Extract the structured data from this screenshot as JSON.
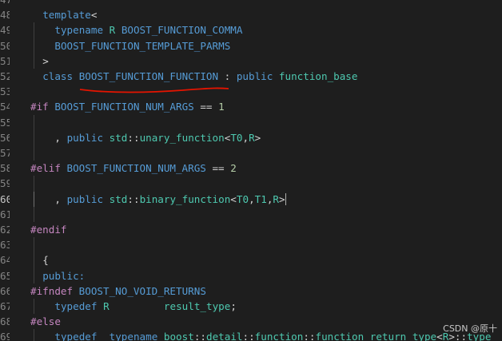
{
  "editor": {
    "lines": [
      {
        "num": "47",
        "tokens": []
      },
      {
        "num": "48",
        "tokens": [
          {
            "t": "template",
            "c": "t-kw"
          },
          {
            "t": "<",
            "c": "t-plain"
          }
        ]
      },
      {
        "num": "49",
        "tokens": [
          {
            "t": "typename ",
            "c": "t-kw"
          },
          {
            "t": "R ",
            "c": "t-param"
          },
          {
            "t": "BOOST_FUNCTION_COMMA",
            "c": "t-mac"
          }
        ]
      },
      {
        "num": "50",
        "tokens": [
          {
            "t": "BOOST_FUNCTION_TEMPLATE_PARMS",
            "c": "t-mac"
          }
        ]
      },
      {
        "num": "51",
        "tokens": [
          {
            "t": ">",
            "c": "t-plain"
          }
        ]
      },
      {
        "num": "52",
        "tokens": [
          {
            "t": "class ",
            "c": "t-kw"
          },
          {
            "t": "BOOST_FUNCTION_FUNCTION",
            "c": "t-mac"
          },
          {
            "t": " : ",
            "c": "t-plain"
          },
          {
            "t": "public ",
            "c": "t-kw"
          },
          {
            "t": "function_base",
            "c": "t-type"
          }
        ]
      },
      {
        "num": "53",
        "tokens": []
      },
      {
        "num": "54",
        "tokens": [
          {
            "t": "#if ",
            "c": "t-pp"
          },
          {
            "t": "BOOST_FUNCTION_NUM_ARGS",
            "c": "t-mac"
          },
          {
            "t": " == ",
            "c": "t-plain"
          },
          {
            "t": "1",
            "c": "t-num"
          }
        ]
      },
      {
        "num": "55",
        "tokens": []
      },
      {
        "num": "56",
        "tokens": [
          {
            "t": ", ",
            "c": "t-plain"
          },
          {
            "t": "public ",
            "c": "t-kw"
          },
          {
            "t": "std",
            "c": "t-ns"
          },
          {
            "t": "::",
            "c": "t-plain"
          },
          {
            "t": "unary_function",
            "c": "t-type"
          },
          {
            "t": "<",
            "c": "t-plain"
          },
          {
            "t": "T0",
            "c": "t-type"
          },
          {
            "t": ",",
            "c": "t-plain"
          },
          {
            "t": "R",
            "c": "t-type"
          },
          {
            "t": ">",
            "c": "t-plain"
          }
        ]
      },
      {
        "num": "57",
        "tokens": []
      },
      {
        "num": "58",
        "tokens": [
          {
            "t": "#elif ",
            "c": "t-pp"
          },
          {
            "t": "BOOST_FUNCTION_NUM_ARGS",
            "c": "t-mac"
          },
          {
            "t": " == ",
            "c": "t-plain"
          },
          {
            "t": "2",
            "c": "t-num"
          }
        ]
      },
      {
        "num": "59",
        "tokens": []
      },
      {
        "num": "60",
        "tokens": [
          {
            "t": ", ",
            "c": "t-plain"
          },
          {
            "t": "public ",
            "c": "t-kw"
          },
          {
            "t": "std",
            "c": "t-ns"
          },
          {
            "t": "::",
            "c": "t-plain"
          },
          {
            "t": "binary_function",
            "c": "t-type"
          },
          {
            "t": "<",
            "c": "t-plain"
          },
          {
            "t": "T0",
            "c": "t-type"
          },
          {
            "t": ",",
            "c": "t-plain"
          },
          {
            "t": "T1",
            "c": "t-type"
          },
          {
            "t": ",",
            "c": "t-plain"
          },
          {
            "t": "R",
            "c": "t-type"
          },
          {
            "t": ">",
            "c": "t-plain"
          }
        ]
      },
      {
        "num": "61",
        "tokens": []
      },
      {
        "num": "62",
        "tokens": [
          {
            "t": "#endif",
            "c": "t-pp"
          }
        ]
      },
      {
        "num": "63",
        "tokens": []
      },
      {
        "num": "64",
        "tokens": [
          {
            "t": "{",
            "c": "t-plain"
          }
        ]
      },
      {
        "num": "65",
        "tokens": [
          {
            "t": "public:",
            "c": "t-kw"
          }
        ]
      },
      {
        "num": "66",
        "tokens": [
          {
            "t": "#ifndef ",
            "c": "t-pp"
          },
          {
            "t": "BOOST_NO_VOID_RETURNS",
            "c": "t-mac"
          }
        ]
      },
      {
        "num": "67",
        "tokens": [
          {
            "t": "typedef ",
            "c": "t-kw"
          },
          {
            "t": "R",
            "c": "t-type"
          },
          {
            "t": "         ",
            "c": "t-plain"
          },
          {
            "t": "result_type",
            "c": "t-type"
          },
          {
            "t": ";",
            "c": "t-plain"
          }
        ]
      },
      {
        "num": "68",
        "tokens": [
          {
            "t": "#else",
            "c": "t-pp"
          }
        ]
      },
      {
        "num": "69",
        "tokens": [
          {
            "t": "typedef  ",
            "c": "t-kw"
          },
          {
            "t": "typename ",
            "c": "t-kw"
          },
          {
            "t": "boost",
            "c": "t-ns"
          },
          {
            "t": "::",
            "c": "t-plain"
          },
          {
            "t": "detail",
            "c": "t-ns"
          },
          {
            "t": "::",
            "c": "t-plain"
          },
          {
            "t": "function",
            "c": "t-ns"
          },
          {
            "t": "::",
            "c": "t-plain"
          },
          {
            "t": "function_return_type",
            "c": "t-type"
          },
          {
            "t": "<",
            "c": "t-plain"
          },
          {
            "t": "R",
            "c": "t-type"
          },
          {
            "t": ">::",
            "c": "t-plain"
          },
          {
            "t": "type",
            "c": "t-type"
          }
        ]
      }
    ],
    "active_line": "60"
  },
  "watermark": "CSDN @原十"
}
